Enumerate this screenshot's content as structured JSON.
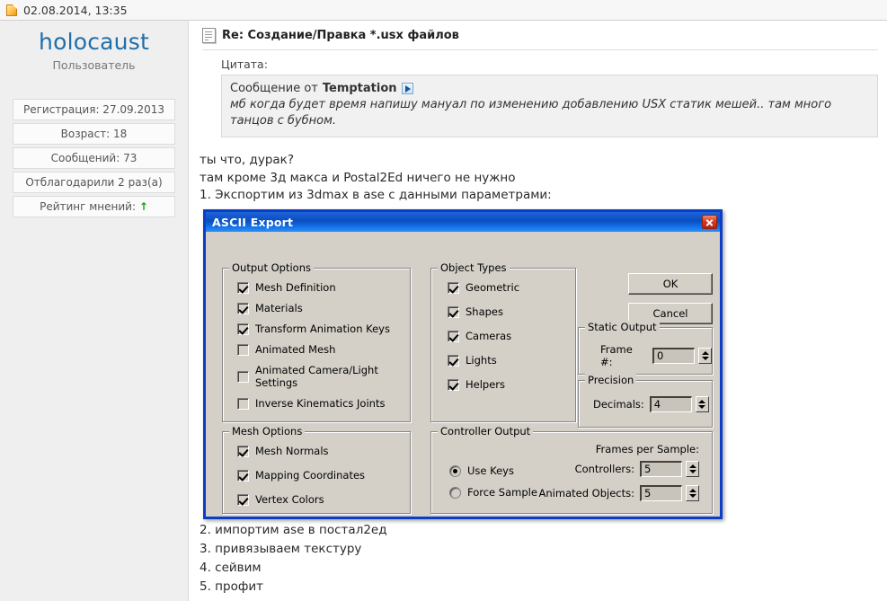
{
  "topbar": {
    "date": "02.08.2014, 13:35",
    "icon": "page-icon"
  },
  "sidebar": {
    "username": "holocaust",
    "usertitle": "Пользователь",
    "stats": [
      {
        "label": "Регистрация: 27.09.2013"
      },
      {
        "label": "Возраст: 18"
      },
      {
        "label": "Сообщений: 73"
      },
      {
        "label": "Отблагодарили 2 раз(а)"
      },
      {
        "label": "Рейтинг мнений:",
        "arrow": "↑"
      }
    ]
  },
  "post": {
    "title": "Re: Создание/Правка *.usx файлов",
    "quote_label": "Цитата:",
    "quote_from_prefix": "Сообщение от",
    "quote_author": "Temptation",
    "quote_text": "мб когда будет время напишу мануал по изменению добавлению USX статик мешей.. там много танцов с бубном.",
    "lines": [
      "ты что, дурак?",
      "там кроме 3д макса и Postal2Ed ничего не нужно",
      "1. Экспортим из 3dmax в ase с данными параметрами:"
    ],
    "tail_lines": [
      "2. импортим ase в постал2ед",
      "3. привязываем текстуру",
      "4. сейвим",
      "5. профит"
    ]
  },
  "dialog": {
    "title": "ASCII Export",
    "close_label": "×",
    "output_options": {
      "title": "Output Options",
      "items": [
        {
          "label": "Mesh Definition",
          "checked": true
        },
        {
          "label": "Materials",
          "checked": true
        },
        {
          "label": "Transform Animation Keys",
          "checked": true
        },
        {
          "label": "Animated Mesh",
          "checked": false
        },
        {
          "label": "Animated Camera/Light Settings",
          "checked": false
        },
        {
          "label": "Inverse Kinematics Joints",
          "checked": false
        }
      ]
    },
    "object_types": {
      "title": "Object Types",
      "items": [
        {
          "label": "Geometric",
          "checked": true
        },
        {
          "label": "Shapes",
          "checked": true
        },
        {
          "label": "Cameras",
          "checked": true
        },
        {
          "label": "Lights",
          "checked": true
        },
        {
          "label": "Helpers",
          "checked": true
        }
      ]
    },
    "mesh_options": {
      "title": "Mesh Options",
      "items": [
        {
          "label": "Mesh Normals",
          "checked": true
        },
        {
          "label": "Mapping Coordinates",
          "checked": true
        },
        {
          "label": "Vertex Colors",
          "checked": true
        }
      ]
    },
    "controller_output": {
      "title": "Controller Output",
      "frames_per_sample_label": "Frames per Sample:",
      "radios": [
        {
          "label": "Use Keys",
          "selected": true
        },
        {
          "label": "Force Sample",
          "selected": false
        }
      ],
      "controllers_label": "Controllers:",
      "controllers_value": "5",
      "animated_objects_label": "Animated Objects:",
      "animated_objects_value": "5"
    },
    "buttons": {
      "ok": "OK",
      "cancel": "Cancel"
    },
    "static_output": {
      "title": "Static Output",
      "frame_label": "Frame #:",
      "frame_value": "0"
    },
    "precision": {
      "title": "Precision",
      "decimals_label": "Decimals:",
      "decimals_value": "4"
    }
  },
  "colors": {
    "titlebar_blue": "#0a4ec1",
    "dialog_face": "#d4d0c8",
    "username_blue": "#1f6fa8",
    "rating_green": "#19a319",
    "close_red": "#dc3b21"
  }
}
